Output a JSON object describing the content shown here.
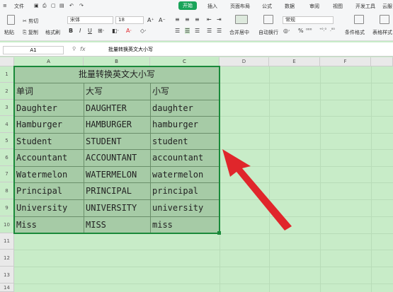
{
  "menu": {
    "file": "文件",
    "tabs": [
      "开始",
      "插入",
      "页面布局",
      "公式",
      "数据",
      "审阅",
      "视图",
      "开发工具",
      "云服"
    ]
  },
  "ribbon": {
    "cut": "剪切",
    "paste": "粘贴",
    "copy": "复制",
    "format_painter": "格式刷",
    "font_name": "宋体",
    "font_size": "18",
    "merge_center": "合并居中",
    "wrap_text": "自动换行",
    "number_format": "常规",
    "conditional_format": "条件格式",
    "table_style": "表格样式"
  },
  "formula_bar": {
    "cell_ref": "A1",
    "fx": "fx",
    "formula": "批量转换英文大小写"
  },
  "columns": [
    "A",
    "B",
    "C",
    "D",
    "E",
    "F"
  ],
  "rows": [
    "1",
    "2",
    "3",
    "4",
    "5",
    "6",
    "7",
    "8",
    "9",
    "10",
    "11",
    "12",
    "13",
    "14"
  ],
  "sheet": {
    "title": "批量转换英文大小写",
    "headers": [
      "单词",
      "大写",
      "小写"
    ],
    "data": [
      [
        "Daughter",
        "DAUGHTER",
        "daughter"
      ],
      [
        "Hamburger",
        "HAMBURGER",
        "hamburger"
      ],
      [
        "Student",
        "STUDENT",
        "student"
      ],
      [
        "Accountant",
        "ACCOUNTANT",
        "accountant"
      ],
      [
        "Watermelon",
        "WATERMELON",
        "watermelon"
      ],
      [
        "Principal",
        "PRINCIPAL",
        "principal"
      ],
      [
        "University",
        "UNIVERSITY",
        "university"
      ],
      [
        "Miss",
        "MISS",
        "miss"
      ]
    ]
  },
  "colors": {
    "accent": "#1aa45a",
    "selection_fill": "#a6cba6",
    "arrow": "#e0262b"
  }
}
